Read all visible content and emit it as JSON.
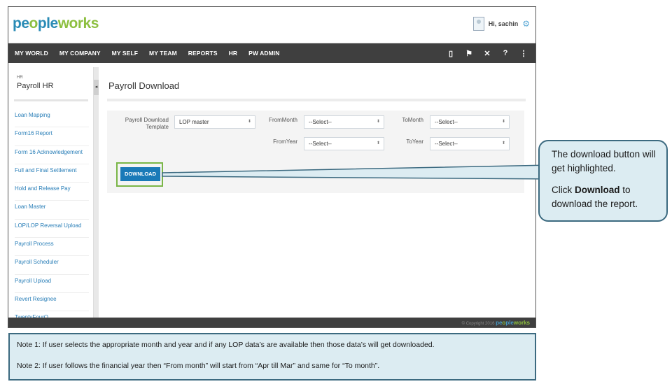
{
  "header": {
    "logo": {
      "part1": "pe",
      "accent": "o",
      "part2": "ple",
      "part3": "works"
    },
    "greeting": "Hi, sachin",
    "icons": {
      "avatar": "user-avatar-icon",
      "settings": "gear-icon"
    }
  },
  "nav": {
    "items": [
      "MY WORLD",
      "MY COMPANY",
      "MY SELF",
      "MY TEAM",
      "REPORTS",
      "HR",
      "PW ADMIN"
    ],
    "icons": [
      {
        "name": "book-icon",
        "glyph": "▯"
      },
      {
        "name": "flag-icon",
        "glyph": "⚑"
      },
      {
        "name": "tools-icon",
        "glyph": "✕"
      },
      {
        "name": "help-icon",
        "glyph": "?"
      },
      {
        "name": "menu-icon",
        "glyph": "⋮"
      }
    ]
  },
  "sidebar": {
    "section": "HR",
    "title": "Payroll HR",
    "items": [
      "Loan Mapping",
      "Form16 Report",
      "Form 16 Acknowledgement",
      "Full and Final Settlement",
      "Hold and Release Pay",
      "Loan Master",
      "LOP/LOP Reversal Upload",
      "Payroll Process",
      "Payroll Scheduler",
      "Payroll Upload",
      "Revert Resignee",
      "TwentyFourQ"
    ],
    "collapse_glyph": "◂"
  },
  "main": {
    "page_title": "Payroll Download",
    "form": {
      "template_label": "Payroll Download Template",
      "template_value": "LOP master",
      "from_month_label": "FromMonth",
      "from_month_value": "--Select--",
      "to_month_label": "ToMonth",
      "to_month_value": "--Select--",
      "from_year_label": "FromYear",
      "from_year_value": "--Select--",
      "to_year_label": "ToYear",
      "to_year_value": "--Select--",
      "chevron_glyph": "⬍"
    },
    "download_label": "DOWNLOAD"
  },
  "footer": {
    "copyright": "© Copyright 2016",
    "logo": {
      "part1": "pe",
      "accent": "o",
      "part2": "ple",
      "part3": "works"
    }
  },
  "callout": {
    "line1": "The download button will get highlighted.",
    "line2_prefix": "Click ",
    "line2_bold": "Download",
    "line2_suffix": " to download the report."
  },
  "notes": {
    "note1": "Note 1:  If user selects the appropriate month and year and if any LOP data’s are available then those data’s will get downloaded.",
    "note2": "Note 2:  If user follows the financial year then “From month” will start from “Apr till Mar” and same for “To month”."
  },
  "colors": {
    "brand_blue": "#2a8bb5",
    "brand_green": "#8cbf3f",
    "nav_bg": "#3f3f3f",
    "button_blue": "#1a7ab8",
    "highlight_green": "#7ab648",
    "callout_bg": "#dcecf2",
    "callout_border": "#3c6a80"
  }
}
